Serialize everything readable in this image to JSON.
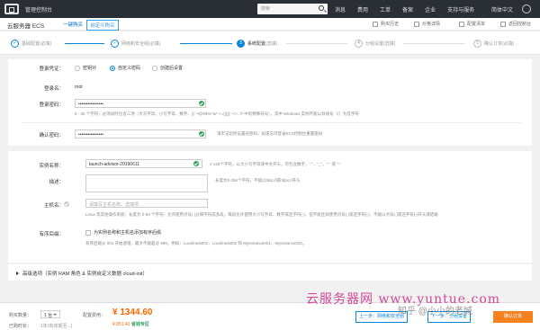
{
  "topbar": {
    "console_title": "管理控制台",
    "search_placeholder": "搜索",
    "nav": [
      "消息",
      "费用",
      "工单",
      "备案",
      "企业",
      "支持与服务"
    ],
    "lang": "简体中文"
  },
  "header": {
    "product": "云服务器 ECS",
    "tab_quick": "一键购买",
    "tab_custom": "自定义购买",
    "links": [
      "购买历史",
      "价格详情",
      "配置清单",
      "返回控制台"
    ]
  },
  "steps": [
    {
      "num": "✓",
      "label": "基础配置",
      "sub": "(必填)"
    },
    {
      "num": "✓",
      "label": "网络和安全组",
      "sub": "(必填)"
    },
    {
      "num": "3",
      "label": "系统配置",
      "sub": "(选填)"
    },
    {
      "num": "4",
      "label": "分组设置",
      "sub": "(选填)"
    },
    {
      "num": "5",
      "label": "确认订单",
      "sub": "(必填)"
    }
  ],
  "login": {
    "label": "登录凭证：",
    "options": [
      "密钥对",
      "自定义密码",
      "创建后设置"
    ],
    "user_label": "登录名：",
    "user_value": "root",
    "pwd_label": "登录密码：",
    "pwd_value": "••••••••••••••••",
    "pwd_hint": "8 - 30 个字符，必须同时包含三项（大写字母、小写字母、数字、()`~!@#$%^&*-+=|{}[]:;'<>,.?/ 中的特殊符号），其中 Windows 实例不能以斜线号（/）为首字符",
    "confirm_label": "确认密码：",
    "confirm_value": "••••••••••••••••",
    "confirm_hint": "请牢记您所设置的密码，如遗忘可登录ECS控制台重置密码"
  },
  "instance": {
    "name_label": "实例名称：",
    "name_value": "launch-advisor-20190611",
    "name_hint": "2-128个字符，以大小写字母或中文开头，可包含数字，\".\"，\"_\"，\":\" 或 \"-\"",
    "desc_label": "描述：",
    "desc_hint": "长度为2-256个字符，不能以http://或https://开头",
    "host_label": "主机名：",
    "host_placeholder": "请填写主机名称，选填项",
    "host_hint": "Linux 等其他操作系统：长度为 2-64 个字符，允许使用点号(.)分隔字符成多段，每段允许使用大小写字母、数字或连字符(-)，但不能连续使用点号(.)或连字符(-)，不能以点号(.)或连字符(-)开头或结尾",
    "order_label": "有序后缀：",
    "order_check": "为实例名称和主机名添加有序后缀",
    "order_hint": "有序后缀从 001 开始递增，最大不能超过 999。例如：LocalHost001，LocalHost002 和 MyInstance001，MyInstance002。"
  },
  "advanced": {
    "label": "高级选项（实例 RAM 角色 & 实例自定义数据 cloud-init）"
  },
  "footer": {
    "qty_label": "购买数量：",
    "qty_value": "1 台",
    "duration_label": "已购时长：",
    "duration_value": "1年(有效期至...)",
    "fee_label": "配置费用：",
    "price": "¥ 1344.60",
    "save": "¥ 851.40",
    "save_label": "省钱专区",
    "prev": "上一步：网络和安全组",
    "next": "下一步：分组设置",
    "confirm": "确认订单"
  },
  "watermark": {
    "text": "云服务器网 www.yuntue.com",
    "zhihu": "知乎 @小小的老城"
  }
}
